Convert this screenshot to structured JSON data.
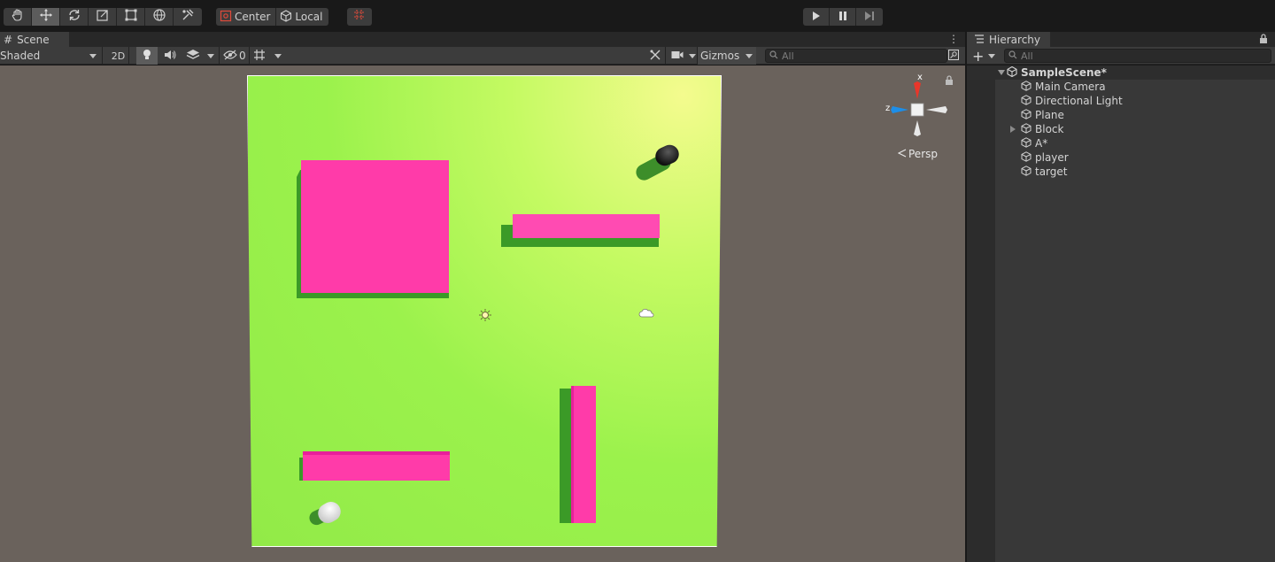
{
  "toolbar": {
    "tools": [
      "hand-tool",
      "move-tool",
      "rotate-tool",
      "scale-tool",
      "rect-tool",
      "transform-tool",
      "custom-tool"
    ],
    "active_tool": "move-tool",
    "pivot_mode": "Center",
    "pivot_rotation": "Local",
    "playback": [
      "play",
      "pause",
      "step"
    ]
  },
  "scene": {
    "tab_label": "Scene",
    "shading_mode": "Shaded",
    "mode_2d": "2D",
    "hidden_count": "0",
    "gizmos_label": "Gizmos",
    "search_placeholder": "All",
    "orientation": {
      "x_label": "x",
      "z_label": "z",
      "projection": "Persp"
    },
    "colors": {
      "background": "#6a625c",
      "plane": "#9bf24c",
      "block": "#ff3ba9",
      "block_shadow": "#3b9a27"
    }
  },
  "hierarchy": {
    "tab_label": "Hierarchy",
    "add_label": "+",
    "search_placeholder": "All",
    "scene_name": "SampleScene*",
    "items": [
      {
        "label": "Main Camera",
        "expandable": false
      },
      {
        "label": "Directional Light",
        "expandable": false
      },
      {
        "label": "Plane",
        "expandable": false
      },
      {
        "label": "Block",
        "expandable": true
      },
      {
        "label": "A*",
        "expandable": false
      },
      {
        "label": "player",
        "expandable": false
      },
      {
        "label": "target",
        "expandable": false
      }
    ]
  }
}
